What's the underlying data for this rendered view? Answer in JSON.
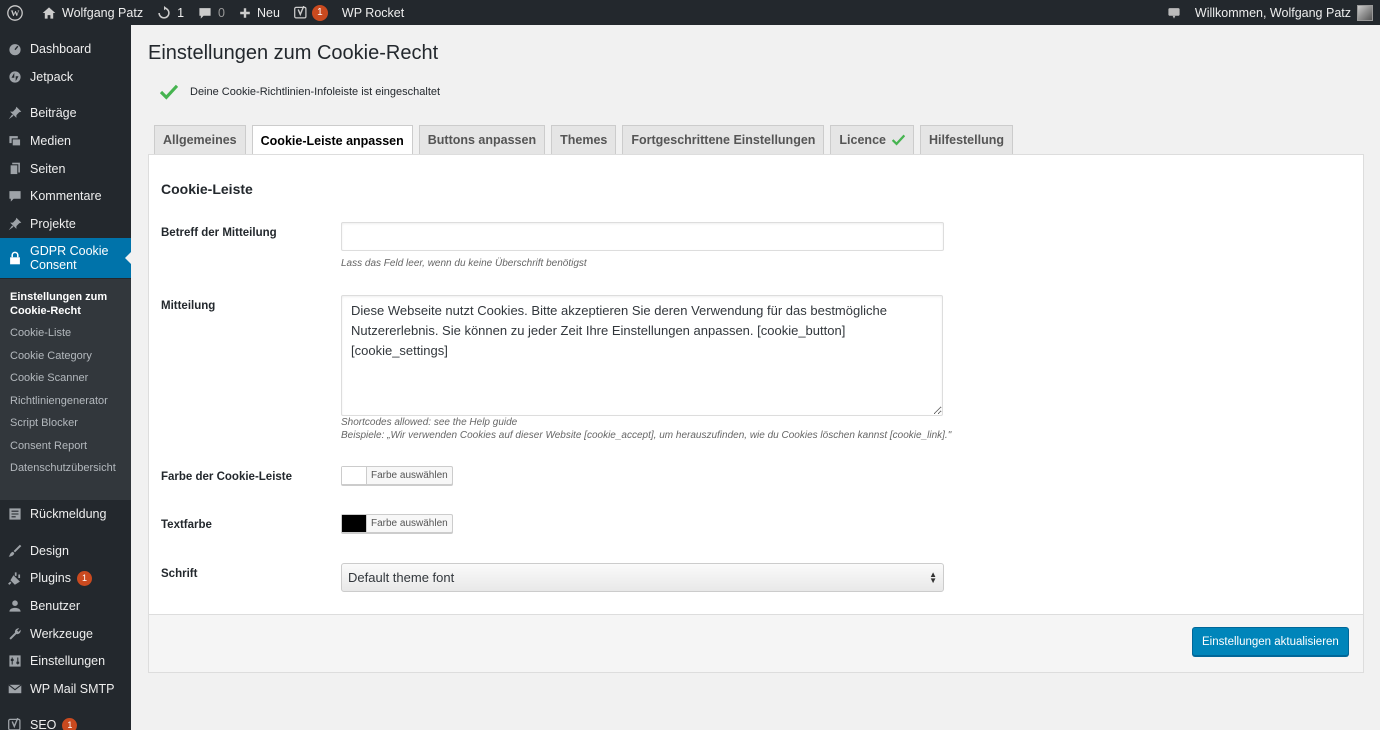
{
  "adminbar": {
    "site_name": "Wolfgang Patz",
    "updates_count": "1",
    "comments_count": "0",
    "new_label": "Neu",
    "yoast_badge": "1",
    "wp_rocket": "WP Rocket",
    "welcome": "Willkommen, Wolfgang Patz"
  },
  "sidebar": {
    "items": [
      {
        "label": "Dashboard",
        "icon": "dashboard-icon"
      },
      {
        "label": "Jetpack",
        "icon": "jetpack-icon"
      },
      {
        "label": "Beiträge",
        "icon": "pin-icon"
      },
      {
        "label": "Medien",
        "icon": "media-icon"
      },
      {
        "label": "Seiten",
        "icon": "pages-icon"
      },
      {
        "label": "Kommentare",
        "icon": "comment-icon"
      },
      {
        "label": "Projekte",
        "icon": "pin-icon"
      },
      {
        "label": "GDPR Cookie Consent",
        "icon": "lock-icon"
      },
      {
        "label": "Rückmeldung",
        "icon": "feedback-icon"
      },
      {
        "label": "Design",
        "icon": "brush-icon"
      },
      {
        "label": "Plugins",
        "icon": "plugin-icon",
        "badge": "1"
      },
      {
        "label": "Benutzer",
        "icon": "user-icon"
      },
      {
        "label": "Werkzeuge",
        "icon": "wrench-icon"
      },
      {
        "label": "Einstellungen",
        "icon": "settings-icon"
      },
      {
        "label": "WP Mail SMTP",
        "icon": "mail-icon"
      },
      {
        "label": "SEO",
        "icon": "yoast-icon",
        "badge": "1"
      }
    ],
    "submenu": [
      "Einstellungen zum Cookie-Recht",
      "Cookie-Liste",
      "Cookie Category",
      "Cookie Scanner",
      "Richtliniengenerator",
      "Script Blocker",
      "Consent Report",
      "Datenschutzübersicht"
    ]
  },
  "page": {
    "title": "Einstellungen zum Cookie-Recht",
    "notice": "Deine Cookie-Richtlinien-Infoleiste ist eingeschaltet"
  },
  "tabs": [
    "Allgemeines",
    "Cookie-Leiste anpassen",
    "Buttons anpassen",
    "Themes",
    "Fortgeschrittene Einstellungen",
    "Licence",
    "Hilfestellung"
  ],
  "form": {
    "section_title": "Cookie-Leiste",
    "subject_label": "Betreff der Mitteilung",
    "subject_value": "",
    "subject_hint": "Lass das Feld leer, wenn du keine Überschrift benötigst",
    "message_label": "Mitteilung",
    "message_value": "Diese Webseite nutzt Cookies. Bitte akzeptieren Sie deren Verwendung für das bestmögliche Nutzererlebnis. Sie können zu jeder Zeit Ihre Einstellungen anpassen. [cookie_button] [cookie_settings]",
    "message_hint1": "Shortcodes allowed: see the Help guide",
    "message_hint2": "Beispiele: „Wir verwenden Cookies auf dieser Website [cookie_accept], um herauszufinden, wie du Cookies löschen kannst [cookie_link].\"",
    "bar_color_label": "Farbe der Cookie-Leiste",
    "bar_color": "#ffffff",
    "text_color_label": "Textfarbe",
    "text_color": "#000000",
    "color_button": "Farbe auswählen",
    "font_label": "Schrift",
    "font_value": "Default theme font",
    "submit": "Einstellungen aktualisieren"
  },
  "colors": {
    "accent": "#0073aa",
    "primary_button": "#0085ba",
    "check_green": "#46b450",
    "badge": "#ca4a1f"
  }
}
